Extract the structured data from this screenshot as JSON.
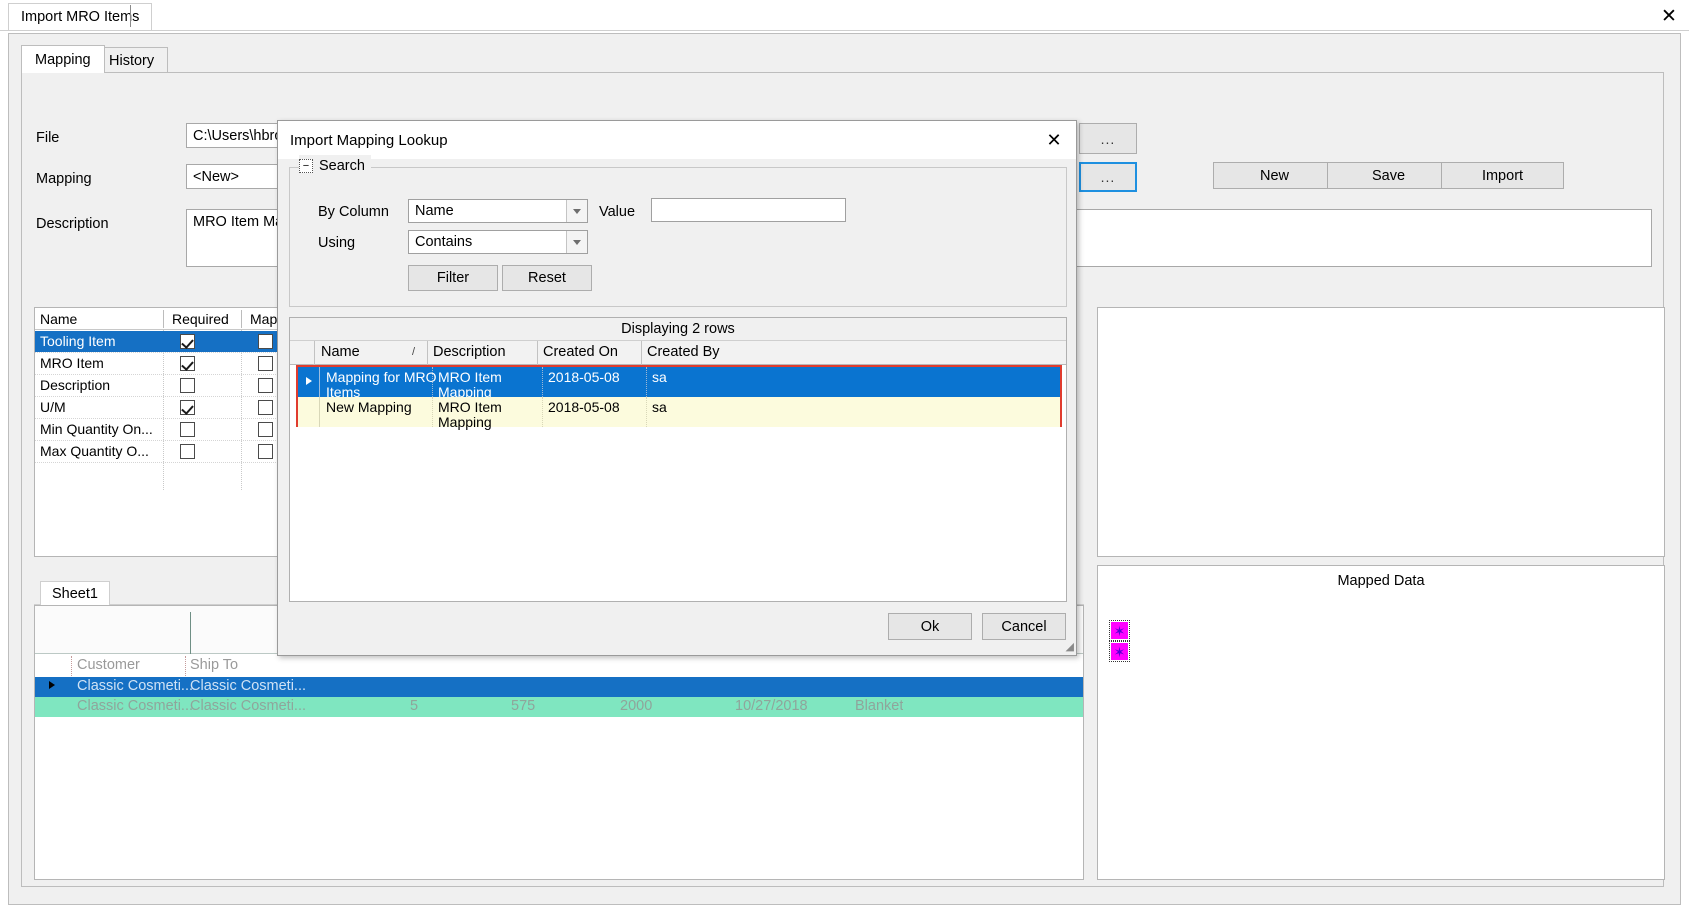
{
  "window": {
    "document_tab": "Import MRO Items",
    "close_icon": "close-icon"
  },
  "tabs": [
    {
      "label": "Mapping",
      "active": true
    },
    {
      "label": "History",
      "active": false
    }
  ],
  "form": {
    "file_label": "File",
    "file_value": "C:\\Users\\hbrocker\\Desktop\\Scripts for Videos\\Classic Cosmetics Order 00000009.xlsx",
    "file_browse": "...",
    "mapping_label": "Mapping",
    "mapping_value": "<New>",
    "mapping_browse": "...",
    "description_label": "Description",
    "description_value": "MRO Item Mapp"
  },
  "toolbar": {
    "new_label": "New",
    "save_label": "Save",
    "import_label": "Import"
  },
  "field_grid": {
    "columns": [
      "Name",
      "Required",
      "Mapped"
    ],
    "rows": [
      {
        "name": "Tooling Item",
        "required": true,
        "mapped": false,
        "selected": true
      },
      {
        "name": "MRO Item",
        "required": true,
        "mapped": false,
        "selected": false
      },
      {
        "name": "Description",
        "required": false,
        "mapped": false,
        "selected": false
      },
      {
        "name": "U/M",
        "required": true,
        "mapped": false,
        "selected": false
      },
      {
        "name": "Min Quantity On...",
        "required": false,
        "mapped": false,
        "selected": false
      },
      {
        "name": "Max Quantity O...",
        "required": false,
        "mapped": false,
        "selected": false
      }
    ]
  },
  "sheet": {
    "tab_label": "Sheet1",
    "columns": [
      "Customer",
      "Ship To"
    ],
    "rows": [
      {
        "customer": "Classic Cosmeti...",
        "ship_to": "Classic Cosmeti...",
        "selected": true
      },
      {
        "customer": "Classic Cosmeti...",
        "ship_to": "Classic Cosmeti...",
        "selected": false
      }
    ],
    "hidden_row_values": [
      "5",
      "575",
      "2000",
      "10/27/2018",
      "Blanket"
    ]
  },
  "mapped_data": {
    "title": "Mapped Data",
    "icons": [
      "star-icon",
      "star-icon"
    ]
  },
  "dialog": {
    "title": "Import Mapping Lookup",
    "close_icon": "close-icon",
    "search": {
      "legend": "Search",
      "expander_glyph": "−",
      "by_column_label": "By Column",
      "by_column_value": "Name",
      "value_label": "Value",
      "value_text": "",
      "value_placeholder": "",
      "using_label": "Using",
      "using_value": "Contains",
      "filter_label": "Filter",
      "reset_label": "Reset"
    },
    "results": {
      "status": "Displaying 2 rows",
      "columns": [
        "Name",
        "Description",
        "Created On",
        "Created By"
      ],
      "sort_indicator": "/",
      "rows": [
        {
          "name": "Mapping for MRO\nItems",
          "description": "MRO Item\nMapping",
          "created_on": "2018-05-08",
          "created_by": "sa",
          "selected": true
        },
        {
          "name": "New Mapping",
          "description": "MRO Item\nMapping",
          "created_on": "2018-05-08",
          "created_by": "sa",
          "selected": false
        }
      ],
      "highlight_color": "#e03c2e"
    },
    "ok_label": "Ok",
    "cancel_label": "Cancel"
  },
  "colors": {
    "selection_blue": "#1570c4",
    "grid_selection_blue": "#0a74d0",
    "alt_row_yellow": "#fcfbdd",
    "green_row": "#7fe6c0",
    "accent_magenta": "#ff00ff",
    "highlight_red": "#e03c2e"
  }
}
